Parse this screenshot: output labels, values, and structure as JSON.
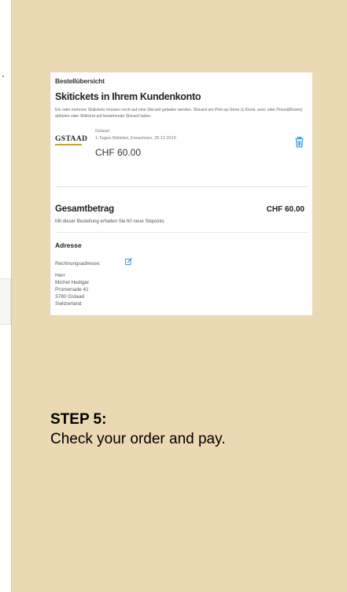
{
  "order": {
    "section_title": "Bestellübersicht",
    "heading": "Skitickets in Ihrem Kundenkonto",
    "info": "Ein oder mehrere Skitickets müssen noch auf eine Skicard geladen werden. Skicard am Pick-up-Store (z.Kiosk, avec oder Press&Books) abholen oder Skiticket auf bestehende Skicard laden.",
    "item": {
      "logo_text": "GSTAAD",
      "location": "Gstaad",
      "description": "1-Tages-Skiticket, Erwachsen, 25.12.2019",
      "price": "CHF 60.00",
      "delete_icon": "trash-icon"
    },
    "total_label": "Gesamtbetrag",
    "total_value": "CHF 60.00",
    "points_note": "Mit dieser Bestellung erhalten Sie 60 neue Skipoints"
  },
  "address": {
    "title": "Adresse",
    "billing_label": "Rechnungsadresse:",
    "edit_icon": "edit-icon",
    "lines": [
      "Herr",
      "Michel Hediger",
      "Promenade 41",
      "3780 Gstaad",
      "Switzerland"
    ]
  },
  "step": {
    "label": "STEP 5:",
    "text": "Check your order and pay."
  },
  "colors": {
    "card_background": "#ead9b3",
    "accent_blue": "#2a8fd4",
    "logo_gold": "#c9a437"
  }
}
